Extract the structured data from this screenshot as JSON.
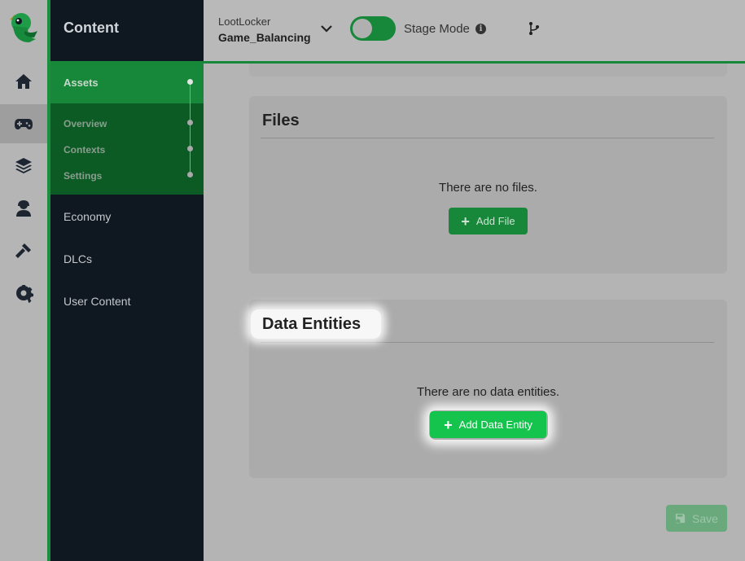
{
  "sidebar": {
    "title": "Content",
    "rail_icons": [
      "parrot-logo",
      "home-icon",
      "gamepad-icon",
      "layers-icon",
      "players-icon",
      "hammer-icon",
      "gear-icon"
    ],
    "assets_label": "Assets",
    "sub_items": [
      {
        "label": "Overview"
      },
      {
        "label": "Contexts"
      },
      {
        "label": "Settings"
      }
    ],
    "links": [
      {
        "label": "Economy"
      },
      {
        "label": "DLCs"
      },
      {
        "label": "User Content"
      }
    ]
  },
  "header": {
    "org_name": "LootLocker",
    "game_name": "Game_Balancing",
    "stage_mode_label": "Stage Mode",
    "stage_mode_on": true
  },
  "main": {
    "files_card": {
      "title": "Files",
      "empty_text": "There are no files.",
      "button_label": "Add File"
    },
    "data_entities_card": {
      "title": "Data Entities",
      "empty_text": "There are no data entities.",
      "button_label": "Add Data Entity"
    },
    "save_label": "Save"
  },
  "colors": {
    "brand_green": "#17883a",
    "bright_green": "#14c44d",
    "sidebar_dark": "#0f1720"
  }
}
